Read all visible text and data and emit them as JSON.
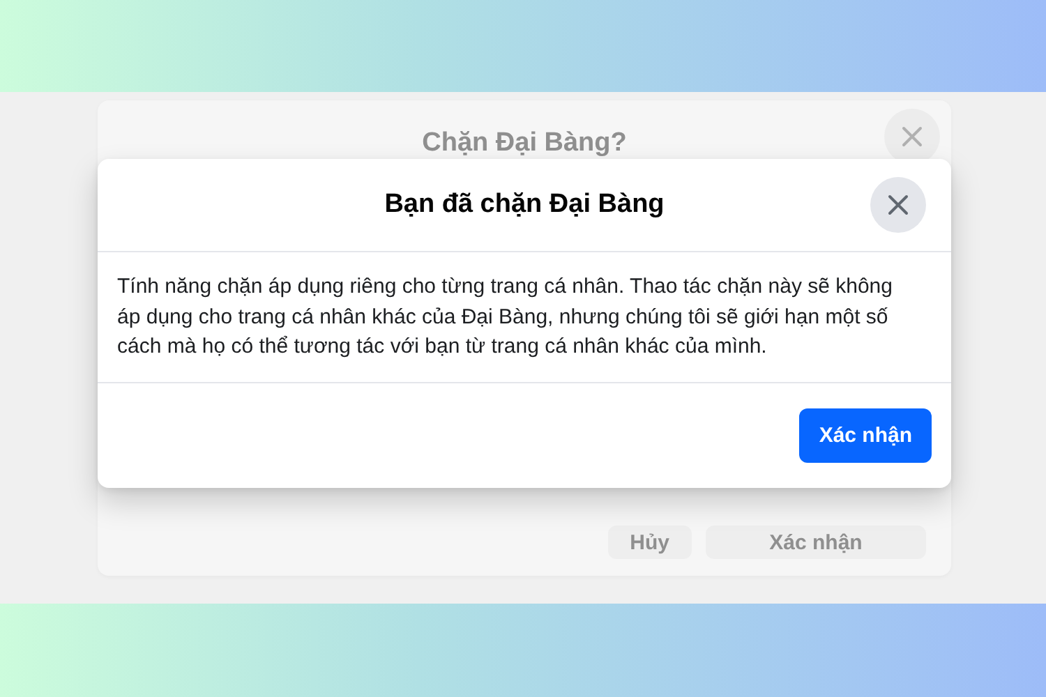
{
  "background_dialog": {
    "title": "Chặn Đại Bàng?",
    "buttons": [
      "Hủy",
      "Xác nhận"
    ]
  },
  "dialog": {
    "title": "Bạn đã chặn Đại Bàng",
    "body": "Tính năng chặn áp dụng riêng cho từng trang cá nhân. Thao tác chặn này sẽ không áp dụng cho trang cá nhân khác của Đại Bàng, nhưng chúng tôi sẽ giới hạn một số cách mà họ có thể tương tác với bạn từ trang cá nhân khác của mình.",
    "buttons": [
      {
        "label": "Xác nhận",
        "kind": "primary"
      }
    ]
  }
}
